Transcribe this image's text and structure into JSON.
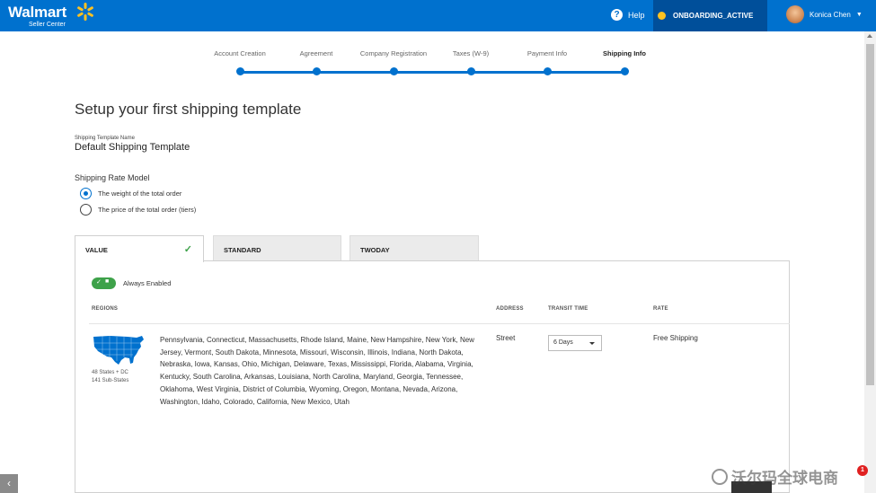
{
  "header": {
    "brand": "Walmart",
    "brand_sub": "Seller Center",
    "help_label": "Help",
    "status_label": "ONBOARDING_ACTIVE",
    "user_name": "Konica Chen",
    "colors": {
      "primary": "#0071ce",
      "status_bg": "#004f9a",
      "status_dot": "#ffc220",
      "spark": "#ffc220"
    }
  },
  "stepper": {
    "steps": [
      {
        "label": "Account Creation"
      },
      {
        "label": "Agreement"
      },
      {
        "label": "Company Registration"
      },
      {
        "label": "Taxes (W-9)"
      },
      {
        "label": "Payment Info"
      },
      {
        "label": "Shipping Info"
      }
    ],
    "active_step": "Shipping Info"
  },
  "page": {
    "title": "Setup your first shipping template",
    "template_name_label": "Shipping Template Name",
    "template_name": "Default Shipping Template",
    "rate_model_label": "Shipping Rate Model",
    "rate_options": [
      {
        "label": "The weight of the total order",
        "checked": true
      },
      {
        "label": "The price of the total order (tiers)",
        "checked": false
      }
    ]
  },
  "tabs": [
    {
      "label": "VALUE",
      "active": true
    },
    {
      "label": "STANDARD",
      "active": false
    },
    {
      "label": "TWODAY",
      "active": false
    }
  ],
  "panel": {
    "toggle_label": "Always Enabled",
    "columns": {
      "regions": "REGIONS",
      "address": "ADDRESS",
      "transit": "TRANSIT TIME",
      "rate": "RATE"
    },
    "row": {
      "map_caption_1": "48 States + DC",
      "map_caption_2": "141 Sub-States",
      "regions": "Pennsylvania, Connecticut, Massachusetts, Rhode Island, Maine, New Hampshire, New York, New Jersey, Vermont, South Dakota, Minnesota, Missouri, Wisconsin, Illinois, Indiana, North Dakota, Nebraska, Iowa, Kansas, Ohio, Michigan, Delaware, Texas, Mississippi, Florida, Alabama, Virginia, Kentucky, South Carolina, Arkansas, Louisiana, North Carolina, Maryland, Georgia, Tennessee, Oklahoma, West Virginia, District of Columbia, Wyoming, Oregon, Montana, Nevada, Arizona, Washington, Idaho, Colorado, California, New Mexico, Utah",
      "address": "Street",
      "transit_time": "6 Days",
      "rate": "Free Shipping"
    }
  },
  "overlay": {
    "watermark": "沃尔玛全球电商",
    "notification_count": "1"
  }
}
